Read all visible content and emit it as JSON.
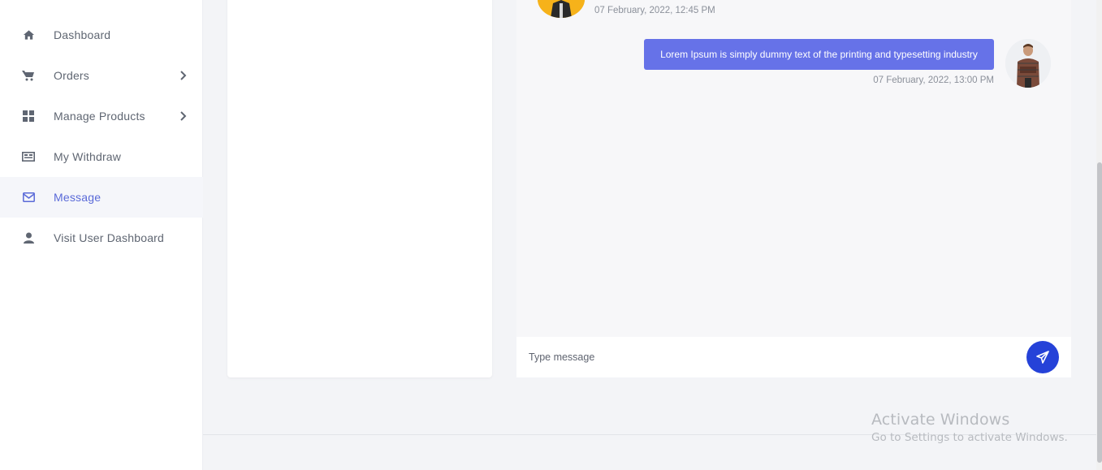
{
  "sidebar": {
    "items": [
      {
        "label": "Dashboard",
        "icon": "home-icon",
        "has_chevron": false,
        "active": false
      },
      {
        "label": "Orders",
        "icon": "cart-icon",
        "has_chevron": true,
        "active": false
      },
      {
        "label": "Manage Products",
        "icon": "grid-icon",
        "has_chevron": true,
        "active": false
      },
      {
        "label": "My Withdraw",
        "icon": "money-icon",
        "has_chevron": false,
        "active": false
      },
      {
        "label": "Message",
        "icon": "envelope-icon",
        "has_chevron": false,
        "active": true
      },
      {
        "label": "Visit User Dashboard",
        "icon": "user-icon",
        "has_chevron": false,
        "active": false
      }
    ]
  },
  "chat": {
    "incoming": {
      "timestamp": "07 February, 2022, 12:45 PM"
    },
    "outgoing": {
      "text": "Lorem Ipsum is simply dummy text of the printing and typesetting industry",
      "timestamp": "07 February, 2022, 13:00 PM"
    },
    "composer": {
      "placeholder": "Type message"
    }
  },
  "watermark": {
    "title": "Activate Windows",
    "subtitle": "Go to Settings to activate Windows."
  },
  "colors": {
    "accent": "#6672e8",
    "send_button": "#2542d8",
    "active_nav": "#5a6ad8"
  }
}
